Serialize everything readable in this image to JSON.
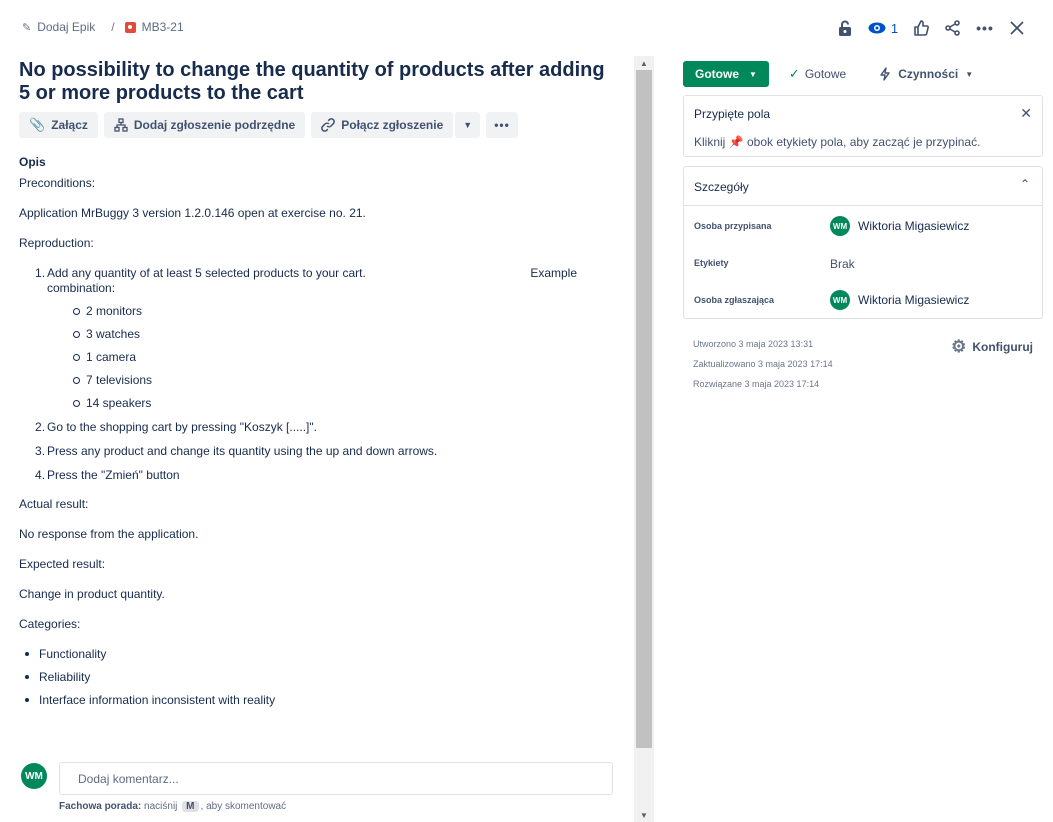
{
  "breadcrumb": {
    "epic_label": "Dodaj Epik",
    "separator": "/",
    "issue_key": "MB3-21"
  },
  "top_actions": {
    "watch_count": "1"
  },
  "issue": {
    "title": "No possibility to change the quantity of products after adding 5 or more products to the cart"
  },
  "toolbar": {
    "attach": "Załącz",
    "add_child": "Dodaj zgłoszenie podrzędne",
    "link": "Połącz zgłoszenie",
    "more": "•••"
  },
  "description": {
    "heading": "Opis",
    "preconditions_label": "Preconditions:",
    "preconditions_text": "Application MrBuggy 3 version 1.2.0.146 open at exercise no. 21.",
    "reproduction_label": "Reproduction:",
    "step1_a": "Add any quantity of at least 5 selected products to your cart.",
    "step1_b": "Example",
    "step1_c": "combination:",
    "combination": [
      "2 monitors",
      "3 watches",
      "1 camera",
      "7 televisions",
      "14 speakers"
    ],
    "step2": "Go to the shopping cart by pressing \"Koszyk [.....]\".",
    "step3": "Press any product and change its quantity using the up and down arrows.",
    "step4": "Press the \"Zmień\" button",
    "actual_label": "Actual result:",
    "actual_text": "No response from the application.",
    "expected_label": "Expected result:",
    "expected_text": "Change in product quantity.",
    "categories_label": "Categories:",
    "categories": [
      "Functionality",
      "Reliability",
      "Interface information inconsistent with reality"
    ]
  },
  "comment": {
    "avatar": "WM",
    "placeholder": "Dodaj komentarz...",
    "tip_bold": "Fachowa porada:",
    "tip_pre": "naciśnij",
    "tip_key": "M",
    "tip_post": ", aby skomentować"
  },
  "status": {
    "button": "Gotowe",
    "done_label": "Gotowe",
    "actions_label": "Czynności"
  },
  "pinned": {
    "title": "Przypięte pola",
    "text_pre": "Kliknij",
    "text_post": "obok etykiety pola, aby zacząć je przypinać."
  },
  "details": {
    "title": "Szczegóły",
    "assignee_label": "Osoba przypisana",
    "assignee_avatar": "WM",
    "assignee_name": "Wiktoria Migasiewicz",
    "labels_label": "Etykiety",
    "labels_value": "Brak",
    "reporter_label": "Osoba zgłaszająca",
    "reporter_avatar": "WM",
    "reporter_name": "Wiktoria Migasiewicz"
  },
  "meta": {
    "created": "Utworzono 3 maja 2023 13:31",
    "updated": "Zaktualizowano 3 maja 2023 17:14",
    "resolved": "Rozwiązane 3 maja 2023 17:14",
    "configure": "Konfiguruj"
  },
  "colors": {
    "status_green": "#00875a",
    "avatar_green": "#00875a",
    "watch_blue": "#0052cc",
    "bug_red": "#e5493a"
  }
}
